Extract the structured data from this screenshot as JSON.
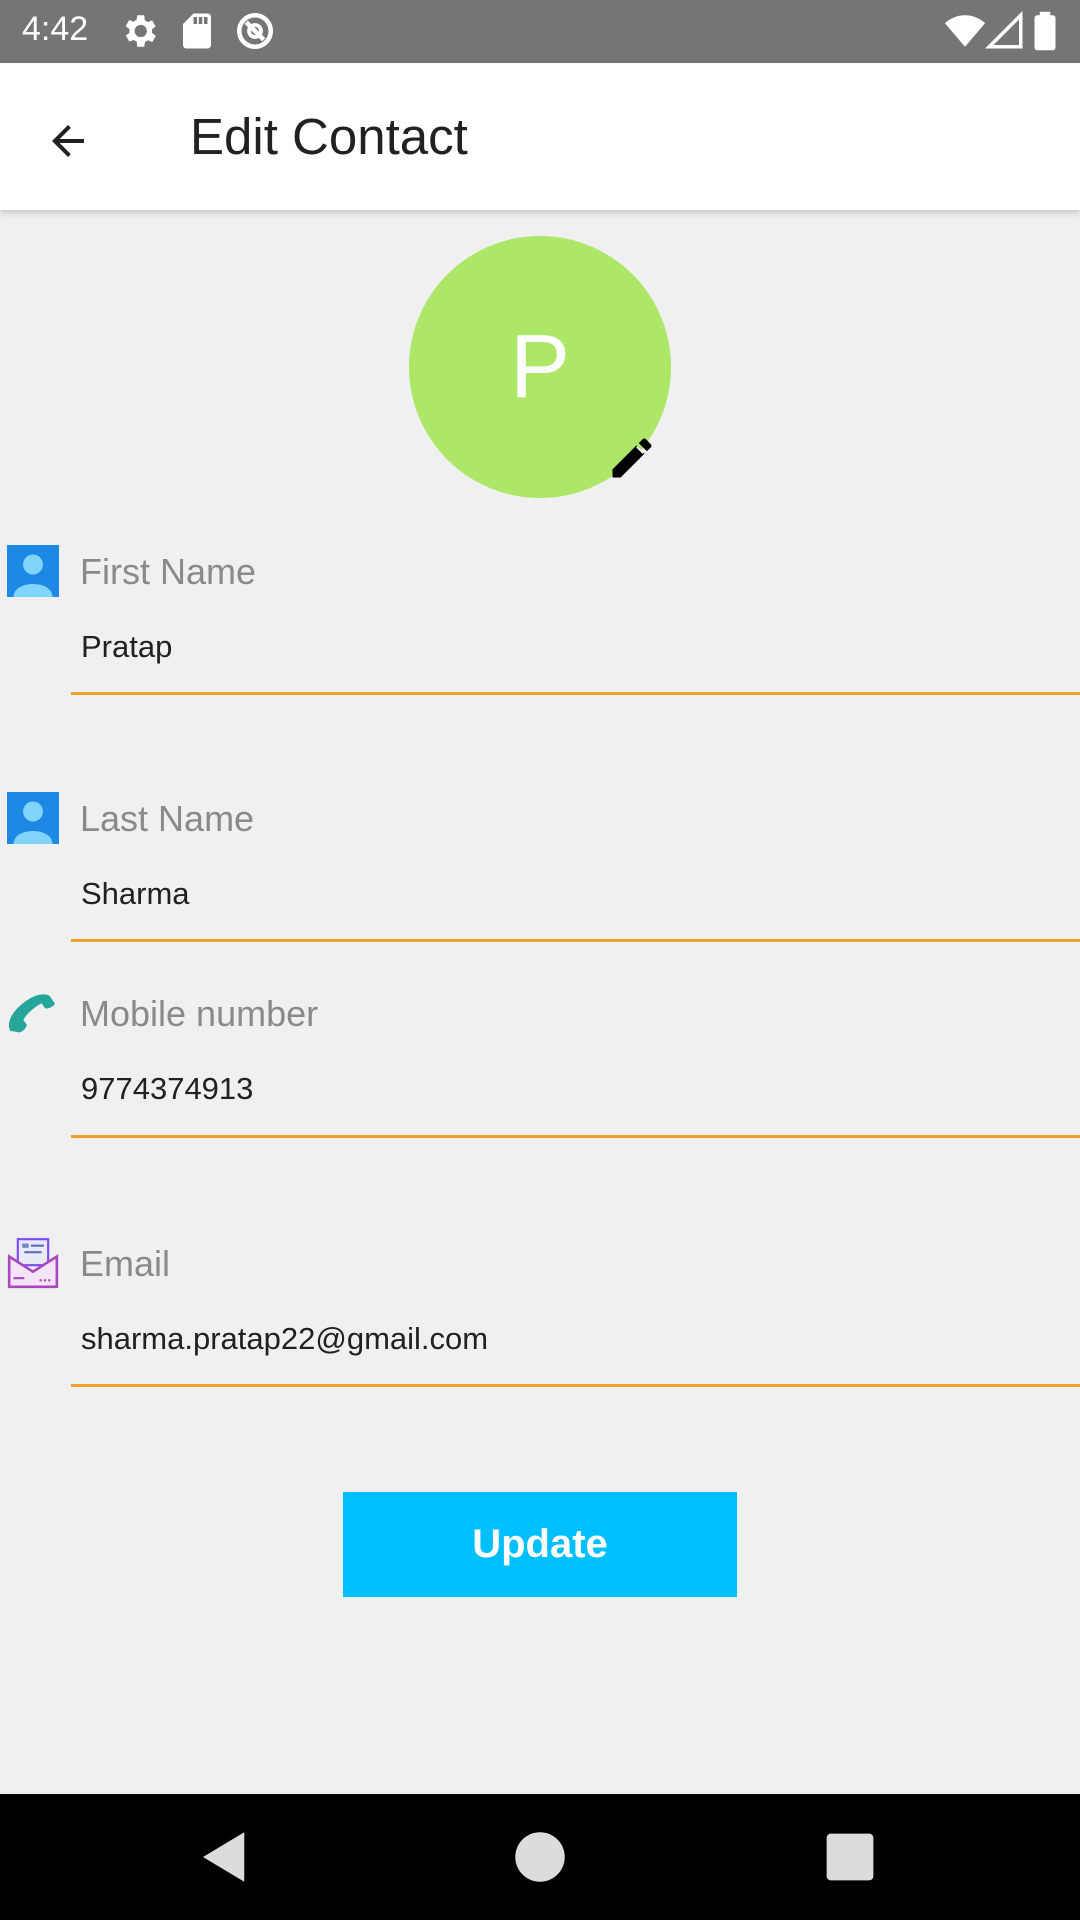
{
  "status_bar": {
    "time": "4:42",
    "left_icons": [
      "gear-icon",
      "sd-card-icon",
      "do-not-disturb-icon"
    ],
    "right_icons": [
      "wifi-icon",
      "cellular-signal-icon",
      "battery-icon"
    ],
    "bg_color": "#757575"
  },
  "header": {
    "title": "Edit Contact",
    "back_icon": "arrow-back-icon"
  },
  "avatar": {
    "initial": "P",
    "bg_color": "#ace768",
    "edit_icon": "pencil-icon"
  },
  "form": {
    "first_name": {
      "label": "First Name",
      "value": "Pratap",
      "icon": "person-icon"
    },
    "last_name": {
      "label": "Last Name",
      "value": "Sharma",
      "icon": "person-icon"
    },
    "mobile": {
      "label": "Mobile number",
      "value": "9774374913",
      "icon": "phone-icon"
    },
    "email": {
      "label": "Email",
      "value": "sharma.pratap22@gmail.com",
      "icon": "envelope-icon"
    },
    "underline_color": "#f1a12a"
  },
  "actions": {
    "update_label": "Update",
    "update_color": "#00bfff"
  },
  "nav_bar": {
    "icons": [
      "nav-back-icon",
      "nav-home-icon",
      "nav-recents-icon"
    ]
  }
}
